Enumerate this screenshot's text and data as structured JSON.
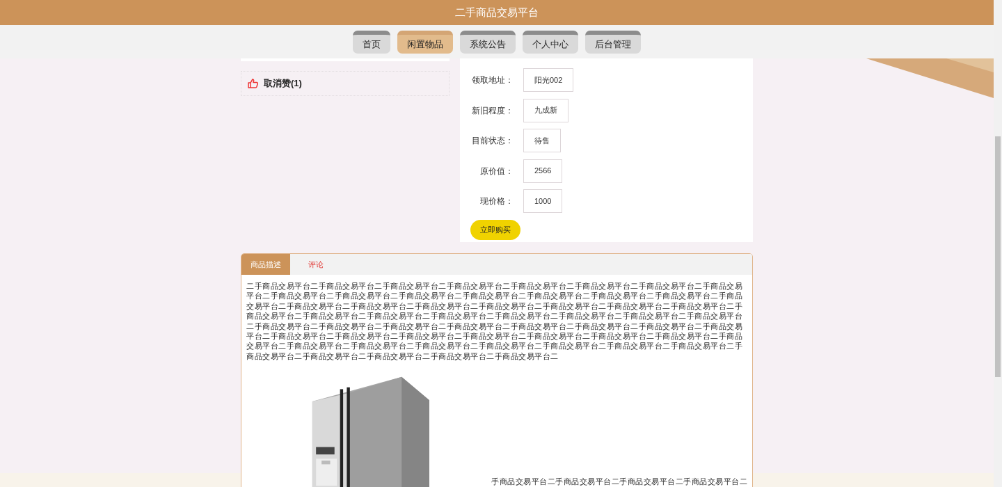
{
  "header": {
    "title": "二手商品交易平台"
  },
  "nav": [
    {
      "label": "首页",
      "selected": false
    },
    {
      "label": "闲置物品",
      "selected": true
    },
    {
      "label": "系统公告",
      "selected": false
    },
    {
      "label": "个人中心",
      "selected": false
    },
    {
      "label": "后台管理",
      "selected": false
    }
  ],
  "like": {
    "label": "取消赞(1)"
  },
  "details": [
    {
      "label": "领取地址：",
      "value": "阳光002"
    },
    {
      "label": "新旧程度：",
      "value": "九成新"
    },
    {
      "label": "目前状态：",
      "value": "待售"
    },
    {
      "label": "原价值：",
      "value": "2566"
    },
    {
      "label": "现价格：",
      "value": "1000"
    }
  ],
  "buy_button": "立即购买",
  "tabs": [
    {
      "label": "商品描述",
      "selected": true
    },
    {
      "label": "评论",
      "selected": false
    }
  ],
  "description": {
    "text": "二手商品交易平台二手商品交易平台二手商品交易平台二手商品交易平台二手商品交易平台二手商品交易平台二手商品交易平台二手商品交易平台二手商品交易平台二手商品交易平台二手商品交易平台二手商品交易平台二手商品交易平台二手商品交易平台二手商品交易平台二手商品交易平台二手商品交易平台二手商品交易平台二手商品交易平台二手商品交易平台二手商品交易平台二手商品交易平台二手商品交易平台二手商品交易平台二手商品交易平台二手商品交易平台二手商品交易平台二手商品交易平台二手商品交易平台二手商品交易平台二手商品交易平台二手商品交易平台二手商品交易平台二手商品交易平台二手商品交易平台二手商品交易平台二手商品交易平台二手商品交易平台二手商品交易平台二手商品交易平台二手商品交易平台二手商品交易平台二手商品交易平台二手商品交易平台二手商品交易平台二手商品交易平台二手商品交易平台二手商品交易平台二手商品交易平台二手商品交易平台二手商品交易平台二手商品交易平台二手商品交易平台二手商品交易平台二手商品交易平台二手商品交易平台二手商品交易平台二手商品交易平台二手商品交易平台二",
    "caption": "手商品交易平台二手商品交易平台二手商品交易平台二手商品交易平台二"
  }
}
